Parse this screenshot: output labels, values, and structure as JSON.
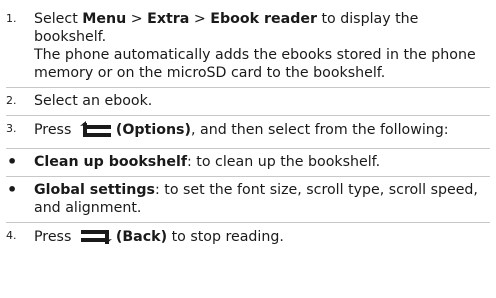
{
  "steps": {
    "step1": {
      "number": "1.",
      "pre": "Select ",
      "menu": "Menu",
      "sep1": " > ",
      "extra": "Extra",
      "sep2": " > ",
      "ebook_reader": "Ebook reader",
      "post": " to display the bookshelf.",
      "note": "The phone automatically adds the ebooks stored in the phone memory or on the microSD card to the bookshelf."
    },
    "step2": {
      "number": "2.",
      "text": "Select an ebook."
    },
    "step3": {
      "number": "3.",
      "pre": "Press ",
      "options_open": "(",
      "options": "Options",
      "options_close": ")",
      "post": ", and then select from the following:"
    },
    "bullets": [
      {
        "term": "Clean up bookshelf",
        "desc": ": to clean up the bookshelf."
      },
      {
        "term": "Global settings",
        "desc": ": to set the font size, scroll type, scroll speed, and alignment."
      }
    ],
    "step4": {
      "number": "4.",
      "pre": "Press ",
      "back": "(Back)",
      "post": " to stop reading."
    }
  },
  "icons": {
    "options_key": "left-softkey-icon",
    "back_key": "right-softkey-icon"
  },
  "colors": {
    "text": "#1a1a1a",
    "separator": "#c8c8c8"
  }
}
